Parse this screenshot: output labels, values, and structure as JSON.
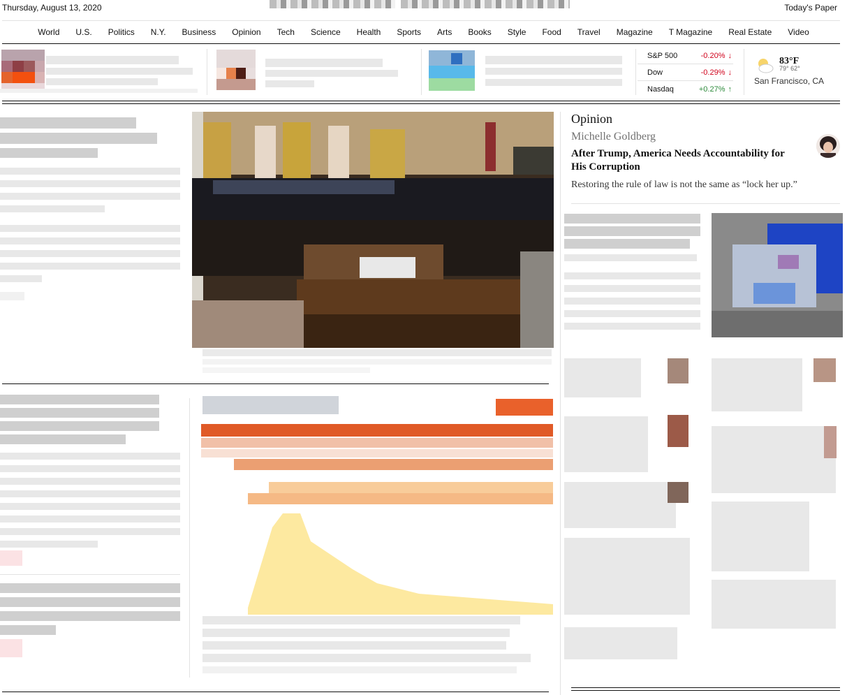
{
  "masthead": {
    "date": "Thursday, August 13, 2020",
    "todays_paper": "Today's Paper"
  },
  "nav": {
    "items": [
      "World",
      "U.S.",
      "Politics",
      "N.Y.",
      "Business",
      "Opinion",
      "Tech",
      "Science",
      "Health",
      "Sports",
      "Arts",
      "Books",
      "Style",
      "Food",
      "Travel",
      "Magazine",
      "T Magazine",
      "Real Estate",
      "Video"
    ]
  },
  "markets": [
    {
      "name": "S&P 500",
      "change": "-0.20%",
      "direction": "down"
    },
    {
      "name": "Dow",
      "change": "-0.29%",
      "direction": "down"
    },
    {
      "name": "Nasdaq",
      "change": "+0.27%",
      "direction": "up"
    }
  ],
  "weather": {
    "temp": "83°F",
    "range": "79° 62°",
    "city": "San Francisco, CA",
    "icon": "partly-cloudy-icon"
  },
  "opinion": {
    "label": "Opinion",
    "author": "Michelle Goldberg",
    "headline": "After Trump, America Needs Accountability for His Corruption",
    "summary": "Restoring the rule of law is not the same as “lock her up.”"
  },
  "colors": {
    "down": "#d0021b",
    "up": "#2e8b3c",
    "rule": "#121212",
    "light_rule": "#e2e2e2"
  }
}
